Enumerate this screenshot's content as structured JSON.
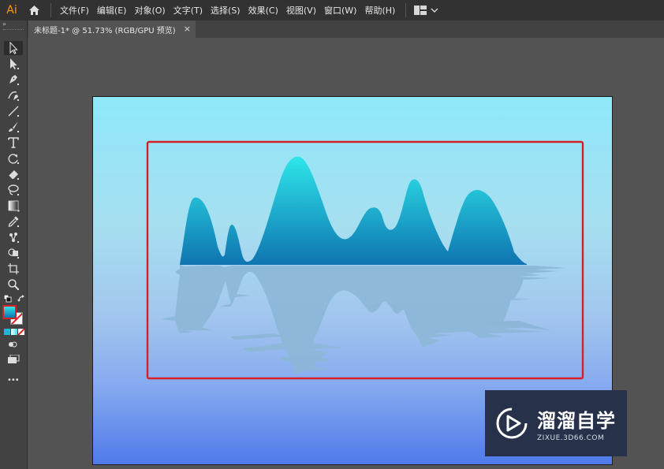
{
  "app": {
    "logo": "Ai"
  },
  "menu": [
    "文件(F)",
    "编辑(E)",
    "对象(O)",
    "文字(T)",
    "选择(S)",
    "效果(C)",
    "视图(V)",
    "窗口(W)",
    "帮助(H)"
  ],
  "tab": {
    "title": "未标题-1* @ 51.73% (RGB/GPU 预览)",
    "close": "×"
  },
  "toolbar": {
    "tools": [
      "selection-tool",
      "direct-selection-tool",
      "pen-tool",
      "curvature-tool",
      "line-tool",
      "paintbrush-tool",
      "type-tool",
      "rotate-tool",
      "eraser-tool",
      "lasso-tool",
      "gradient-tool",
      "eyedropper-tool",
      "puppet-warp-tool",
      "shape-builder-tool",
      "artboard-tool",
      "zoom-tool"
    ],
    "more_label": "•••"
  },
  "watermark": {
    "title": "溜溜自学",
    "subtitle": "ZIXUE.3D66.COM"
  },
  "colors": {
    "mountain_top": "#2ee6ea",
    "mountain_bottom": "#0f74b0",
    "reflection": "#8db7d8",
    "selection_box": "#d62027"
  }
}
